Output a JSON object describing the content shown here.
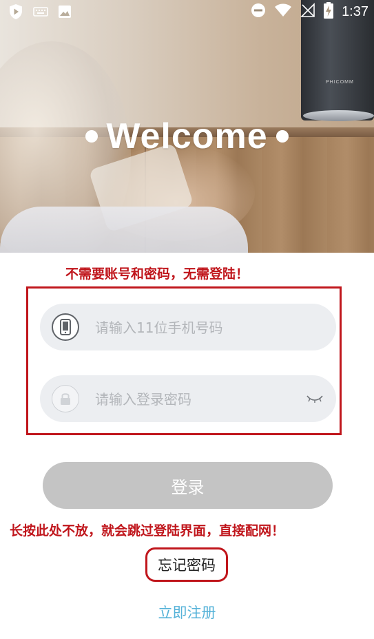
{
  "status_bar": {
    "time": "1:37",
    "icons_left": [
      "shield-play-icon",
      "keyboard-icon",
      "image-icon"
    ],
    "icons_right": [
      "do-not-disturb-icon",
      "wifi-icon",
      "no-signal-icon",
      "battery-charging-icon"
    ]
  },
  "hero": {
    "welcome_text": "Welcome",
    "device_label": "PHICOMM"
  },
  "annotations": {
    "top_note": "不需要账号和密码，无需登陆！",
    "middle_note": "长按此处不放，就会跳过登陆界面，直接配网！"
  },
  "form": {
    "phone_placeholder": "请输入11位手机号码",
    "phone_value": "",
    "password_placeholder": "请输入登录密码",
    "password_value": "",
    "login_label": "登录",
    "forgot_label": "忘记密码",
    "register_label": "立即注册"
  },
  "colors": {
    "annotation_red": "#c0161c",
    "button_disabled": "#c4c4c4",
    "field_bg": "#eceef1",
    "link_blue": "#55b2d8"
  }
}
